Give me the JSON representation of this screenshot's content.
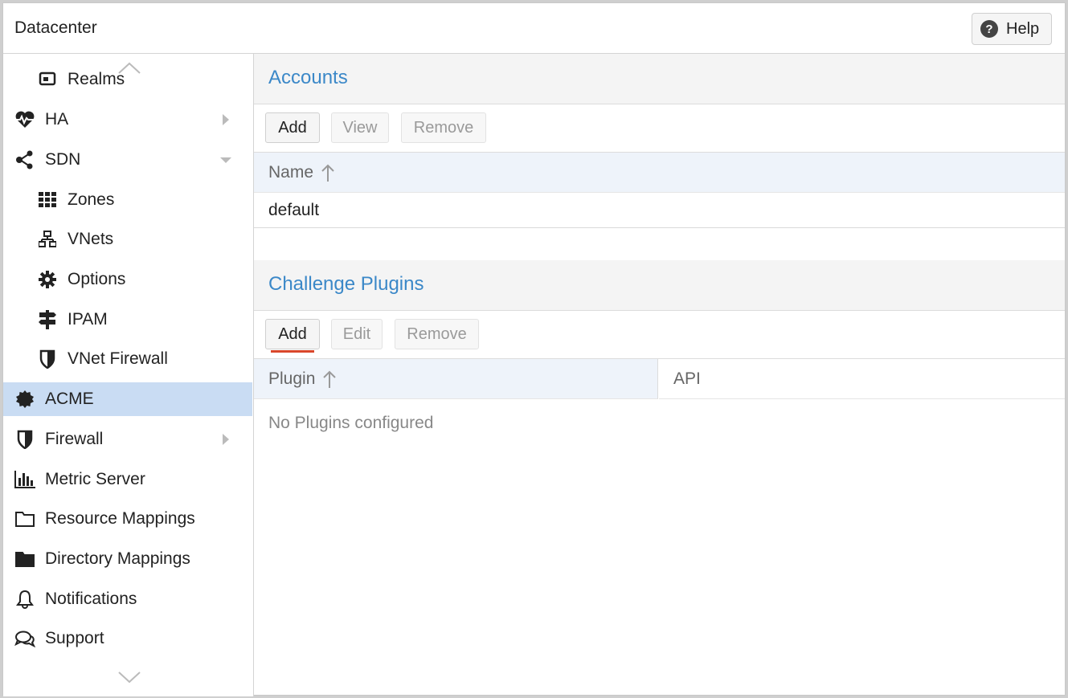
{
  "header": {
    "title": "Datacenter",
    "help_label": "Help"
  },
  "sidebar": {
    "partial_item": "Realms",
    "items": [
      {
        "label": "HA",
        "icon": "heartbeat-icon",
        "expandable": true
      },
      {
        "label": "SDN",
        "icon": "sdn-network-icon",
        "expanded": true
      },
      {
        "label": "Zones",
        "icon": "grid-icon"
      },
      {
        "label": "VNets",
        "icon": "sitemap-icon"
      },
      {
        "label": "Options",
        "icon": "gear-icon"
      },
      {
        "label": "IPAM",
        "icon": "signpost-icon"
      },
      {
        "label": "VNet Firewall",
        "icon": "shield-icon"
      },
      {
        "label": "ACME",
        "icon": "certificate-icon",
        "active": true
      },
      {
        "label": "Firewall",
        "icon": "shield-icon",
        "expandable": true
      },
      {
        "label": "Metric Server",
        "icon": "bar-chart-icon"
      },
      {
        "label": "Resource Mappings",
        "icon": "folder-outline-icon"
      },
      {
        "label": "Directory Mappings",
        "icon": "folder-icon"
      },
      {
        "label": "Notifications",
        "icon": "bell-icon"
      },
      {
        "label": "Support",
        "icon": "comments-icon"
      }
    ]
  },
  "accounts": {
    "title": "Accounts",
    "buttons": {
      "add": "Add",
      "view": "View",
      "remove": "Remove"
    },
    "column_name": "Name",
    "rows": [
      "default"
    ]
  },
  "plugins": {
    "title": "Challenge Plugins",
    "buttons": {
      "add": "Add",
      "edit": "Edit",
      "remove": "Remove"
    },
    "column_plugin": "Plugin",
    "column_api": "API",
    "empty_text": "No Plugins configured"
  },
  "colors": {
    "accent": "#3b88c8",
    "active_bg": "#c9dcf3",
    "focus": "#d9472b"
  }
}
